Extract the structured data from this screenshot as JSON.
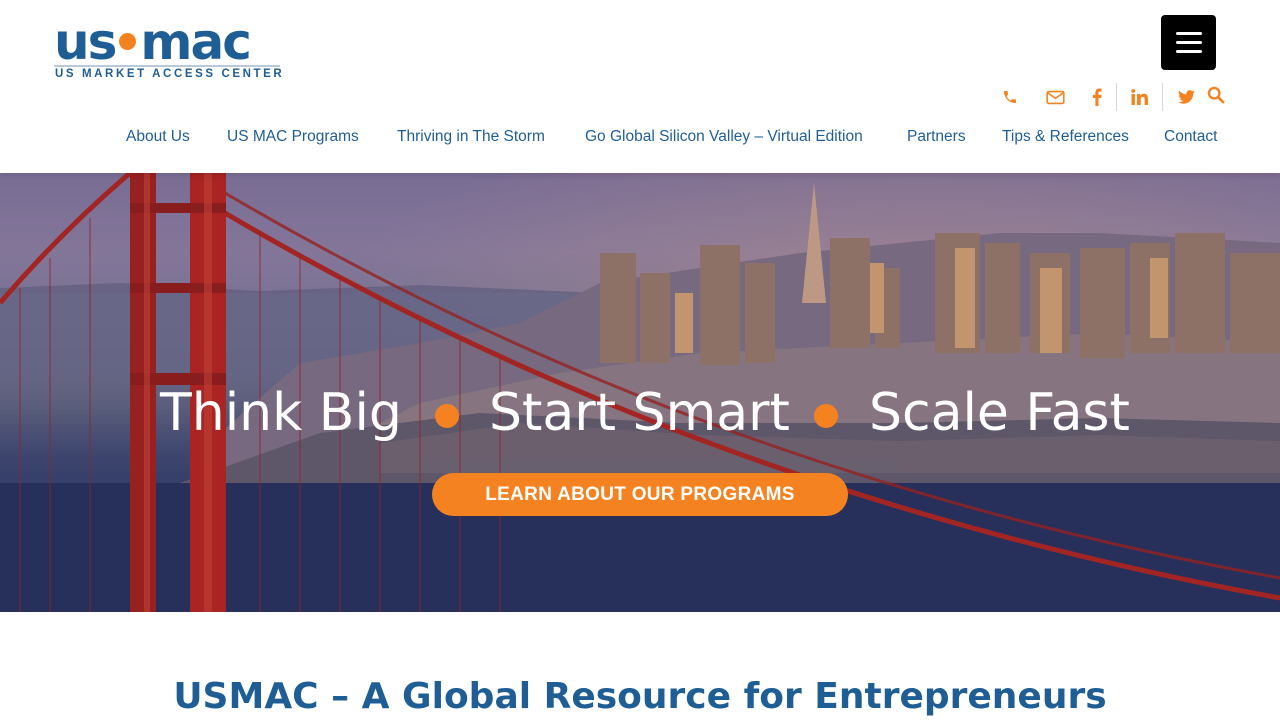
{
  "brand": {
    "logo_part1": "us",
    "logo_part2": "mac",
    "logo_tagline": "US MARKET ACCESS CENTER",
    "accent_color": "#f58220",
    "primary_color": "#1f5e94"
  },
  "header": {
    "menu_toggle_icon": "hamburger-menu-icon",
    "social_icons": [
      "phone-icon",
      "email-icon",
      "facebook-icon",
      "linkedin-icon",
      "twitter-icon",
      "search-icon"
    ]
  },
  "nav": {
    "items": [
      {
        "label": "About Us"
      },
      {
        "label": "US MAC Programs"
      },
      {
        "label": "Thriving in The Storm"
      },
      {
        "label": "Go Global Silicon Valley – Virtual Edition"
      },
      {
        "label": "Partners"
      },
      {
        "label": "Tips & References"
      },
      {
        "label": "Contact"
      }
    ]
  },
  "hero": {
    "tagline": [
      "Think Big",
      "Start Smart",
      "Scale Fast"
    ],
    "cta_label": "LEARN ABOUT OUR PROGRAMS"
  },
  "main": {
    "title": "USMAC – A Global Resource for Entrepreneurs"
  }
}
